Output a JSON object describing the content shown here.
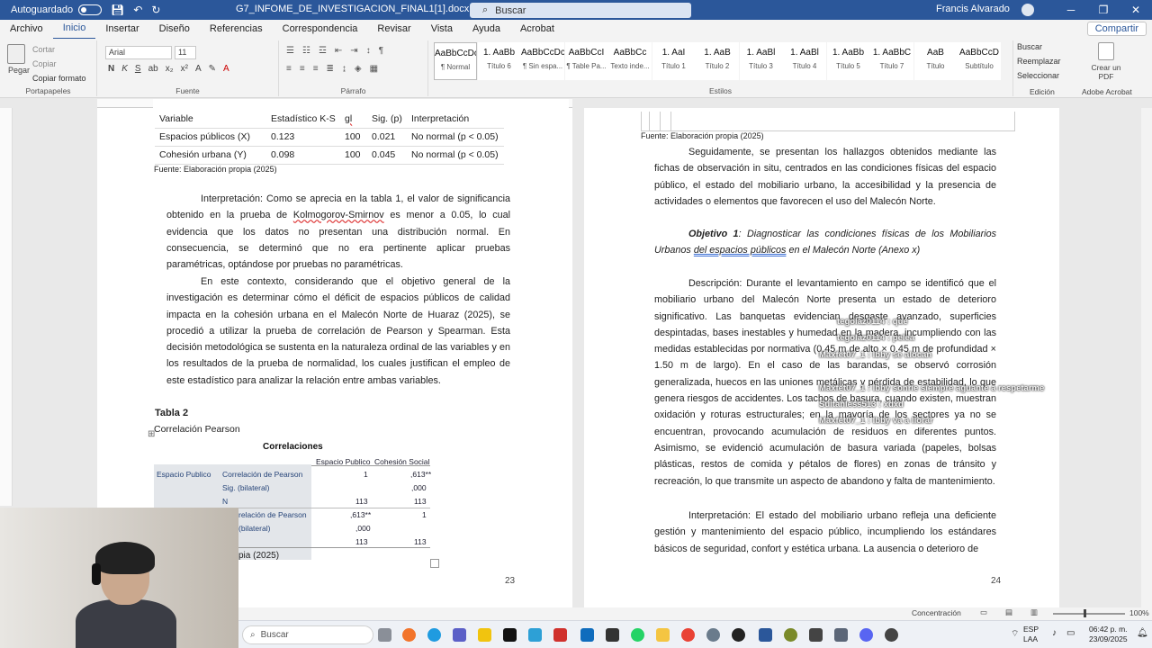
{
  "titlebar": {
    "autosave_label": "Autoguardado",
    "doc_title": "G7_INFOME_DE_INVESTIGACION_FINAL1[1].docx",
    "search_placeholder": "Buscar",
    "user_name": "Francis Alvarado"
  },
  "tabs": [
    "Archivo",
    "Inicio",
    "Insertar",
    "Diseño",
    "Referencias",
    "Correspondencia",
    "Revisar",
    "Vista",
    "Ayuda",
    "Acrobat"
  ],
  "share_label": "Compartir",
  "ribbon": {
    "clipboard": {
      "paste": "Pegar",
      "cut": "Cortar",
      "copy": "Copiar",
      "format_painter": "Copiar formato",
      "group": "Portapapeles"
    },
    "font": {
      "family": "Arial",
      "size": "11",
      "group": "Fuente"
    },
    "paragraph_group": "Párrafo",
    "styles": [
      {
        "preview": "AaBbCcDc",
        "name": "¶ Normal"
      },
      {
        "preview": "1. AaBb",
        "name": "Título 6"
      },
      {
        "preview": "AaBbCcDc",
        "name": "¶ Sin espa..."
      },
      {
        "preview": "AaBbCcI",
        "name": "¶ Table Pa..."
      },
      {
        "preview": "AaBbCc",
        "name": "Texto inde..."
      },
      {
        "preview": "1. AaI",
        "name": "Título 1"
      },
      {
        "preview": "1. AaB",
        "name": "Título 2"
      },
      {
        "preview": "1. AaBl",
        "name": "Título 3"
      },
      {
        "preview": "1. AaBl",
        "name": "Título 4"
      },
      {
        "preview": "1. AaBb",
        "name": "Título 5"
      },
      {
        "preview": "1. AaBbC",
        "name": "Título 7"
      },
      {
        "preview": "AaB",
        "name": "Título"
      },
      {
        "preview": "AaBbCcD",
        "name": "Subtítulo"
      }
    ],
    "styles_group": "Estilos",
    "editing": {
      "find": "Buscar",
      "replace": "Reemplazar",
      "select": "Seleccionar",
      "group": "Edición"
    },
    "pdf": {
      "label": "Crear un PDF",
      "group": "Adobe Acrobat"
    }
  },
  "page1": {
    "table1": {
      "headers": [
        "Variable",
        "Estadístico K-S",
        "gl",
        "Sig. (p)",
        "Interpretación"
      ],
      "rows": [
        [
          "Espacios públicos (X)",
          "0.123",
          "100",
          "0.021",
          "No normal (p < 0.05)"
        ],
        [
          "Cohesión urbana (Y)",
          "0.098",
          "100",
          "0.045",
          "No normal (p < 0.05)"
        ]
      ]
    },
    "source1": "Fuente: Elaboración propia (2025)",
    "para1_a": "Interpretación: Como se aprecia en la tabla 1, el valor de significancia obtenido en la prueba de ",
    "para1_ks": "Kolmogorov-Smirnov",
    "para1_b": " es menor a 0.05, lo cual evidencia que los datos no presentan una distribución normal. En consecuencia, se determinó que no era pertinente aplicar pruebas paramétricas, optándose por pruebas no paramétricas.",
    "para2": "En este contexto, considerando que el objetivo general de la investigación es determinar cómo el déficit de espacios públicos de calidad impacta en la cohesión urbana en el Malecón Norte de Huaraz (2025), se procedió a utilizar la prueba de correlación de Pearson y Spearman. Esta decisión metodológica se sustenta en la naturaleza ordinal de las variables y en los resultados de la prueba de normalidad, los cuales justifican el empleo de este estadístico para analizar la relación entre ambas variables.",
    "table2_title": "Tabla 2",
    "table2_subtitle": "Correlación Pearson",
    "corr": {
      "title": "Correlaciones",
      "col1": "Espacio Publico",
      "col2": "Cohesión Social",
      "row_var": "Espacio Publico",
      "r1": "Correlación de Pearson",
      "r2": "Sig. (bilateral)",
      "r3": "N",
      "r4": "relación de Pearson",
      "r5": "(bilateral)",
      "v11": "1",
      "v12": ",613**",
      "v22": ",000",
      "v31": "113",
      "v32": "113",
      "v41": ",613**",
      "v42": "1",
      "v51": ",000",
      "v61": "113",
      "v62": "113"
    },
    "source2": "pia (2025)",
    "page_number": "23"
  },
  "page2": {
    "source": "Fuente: Elaboración propia (2025)",
    "para1": "Seguidamente, se presentan los hallazgos obtenidos mediante las fichas de observación in situ, centrados en las condiciones físicas del espacio público, el estado del mobiliario urbano, la accesibilidad y la presencia de actividades o elementos que favorecen el uso del Malecón Norte.",
    "obj_label": "Objetivo 1",
    "obj_text_a": ": Diagnosticar las condiciones físicas de los Mobiliarios Urbanos ",
    "obj_text_u": "del espacios públicos",
    "obj_text_b": " en el Malecón Norte (Anexo x)",
    "para2": "Descripción: Durante el levantamiento en campo se identificó que el mobiliario urbano del Malecón Norte presenta un estado de deterioro significativo. Las banquetas evidencian desgaste avanzado, superficies despintadas, bases inestables y humedad en la madera, incumpliendo con las medidas establecidas por normativa (0.45 m de alto × 0.45 m de profundidad × 1.50 m de largo). En el caso de las barandas, se observó corrosión generalizada, huecos en las uniones metálicas y pérdida de estabilidad, lo que genera riesgos de accidentes. Los tachos de basura, cuando existen, muestran oxidación y roturas estructurales; en la mayoría de los sectores ya no se encuentran, provocando acumulación de residuos en diferentes puntos. Asimismo, se evidenció acumulación de basura variada (papeles, bolsas plásticas, restos de comida y pétalos de flores) en zonas de tránsito y recreación, lo que transmite un aspecto de abandono y falta de mantenimiento.",
    "para3": "Interpretación: El estado del mobiliario urbano refleja una deficiente gestión y mantenimiento del espacio público, incumpliendo los estándares básicos de seguridad, confort y estética urbana. La ausencia o deterioro de",
    "page_number": "24"
  },
  "chat_overlay": [
    "tegolaz0114 : que",
    "tegolaz0114 : pelea",
    "Maxfet07_1 : Ibby se alocan",
    "Maxfet07_1 : Ibby sonrie siempre aguante a respetarme",
    "Sultanless513 : xdxd",
    "Maxfet07_1 : Ibby va a llorar"
  ],
  "statusbar": {
    "focus": "Concentración",
    "zoom": "100%"
  },
  "taskbar": {
    "search": "Buscar",
    "lang": "ESP",
    "lang2": "LAA",
    "time": "06:42 p. m.",
    "date": "23/09/2025"
  }
}
